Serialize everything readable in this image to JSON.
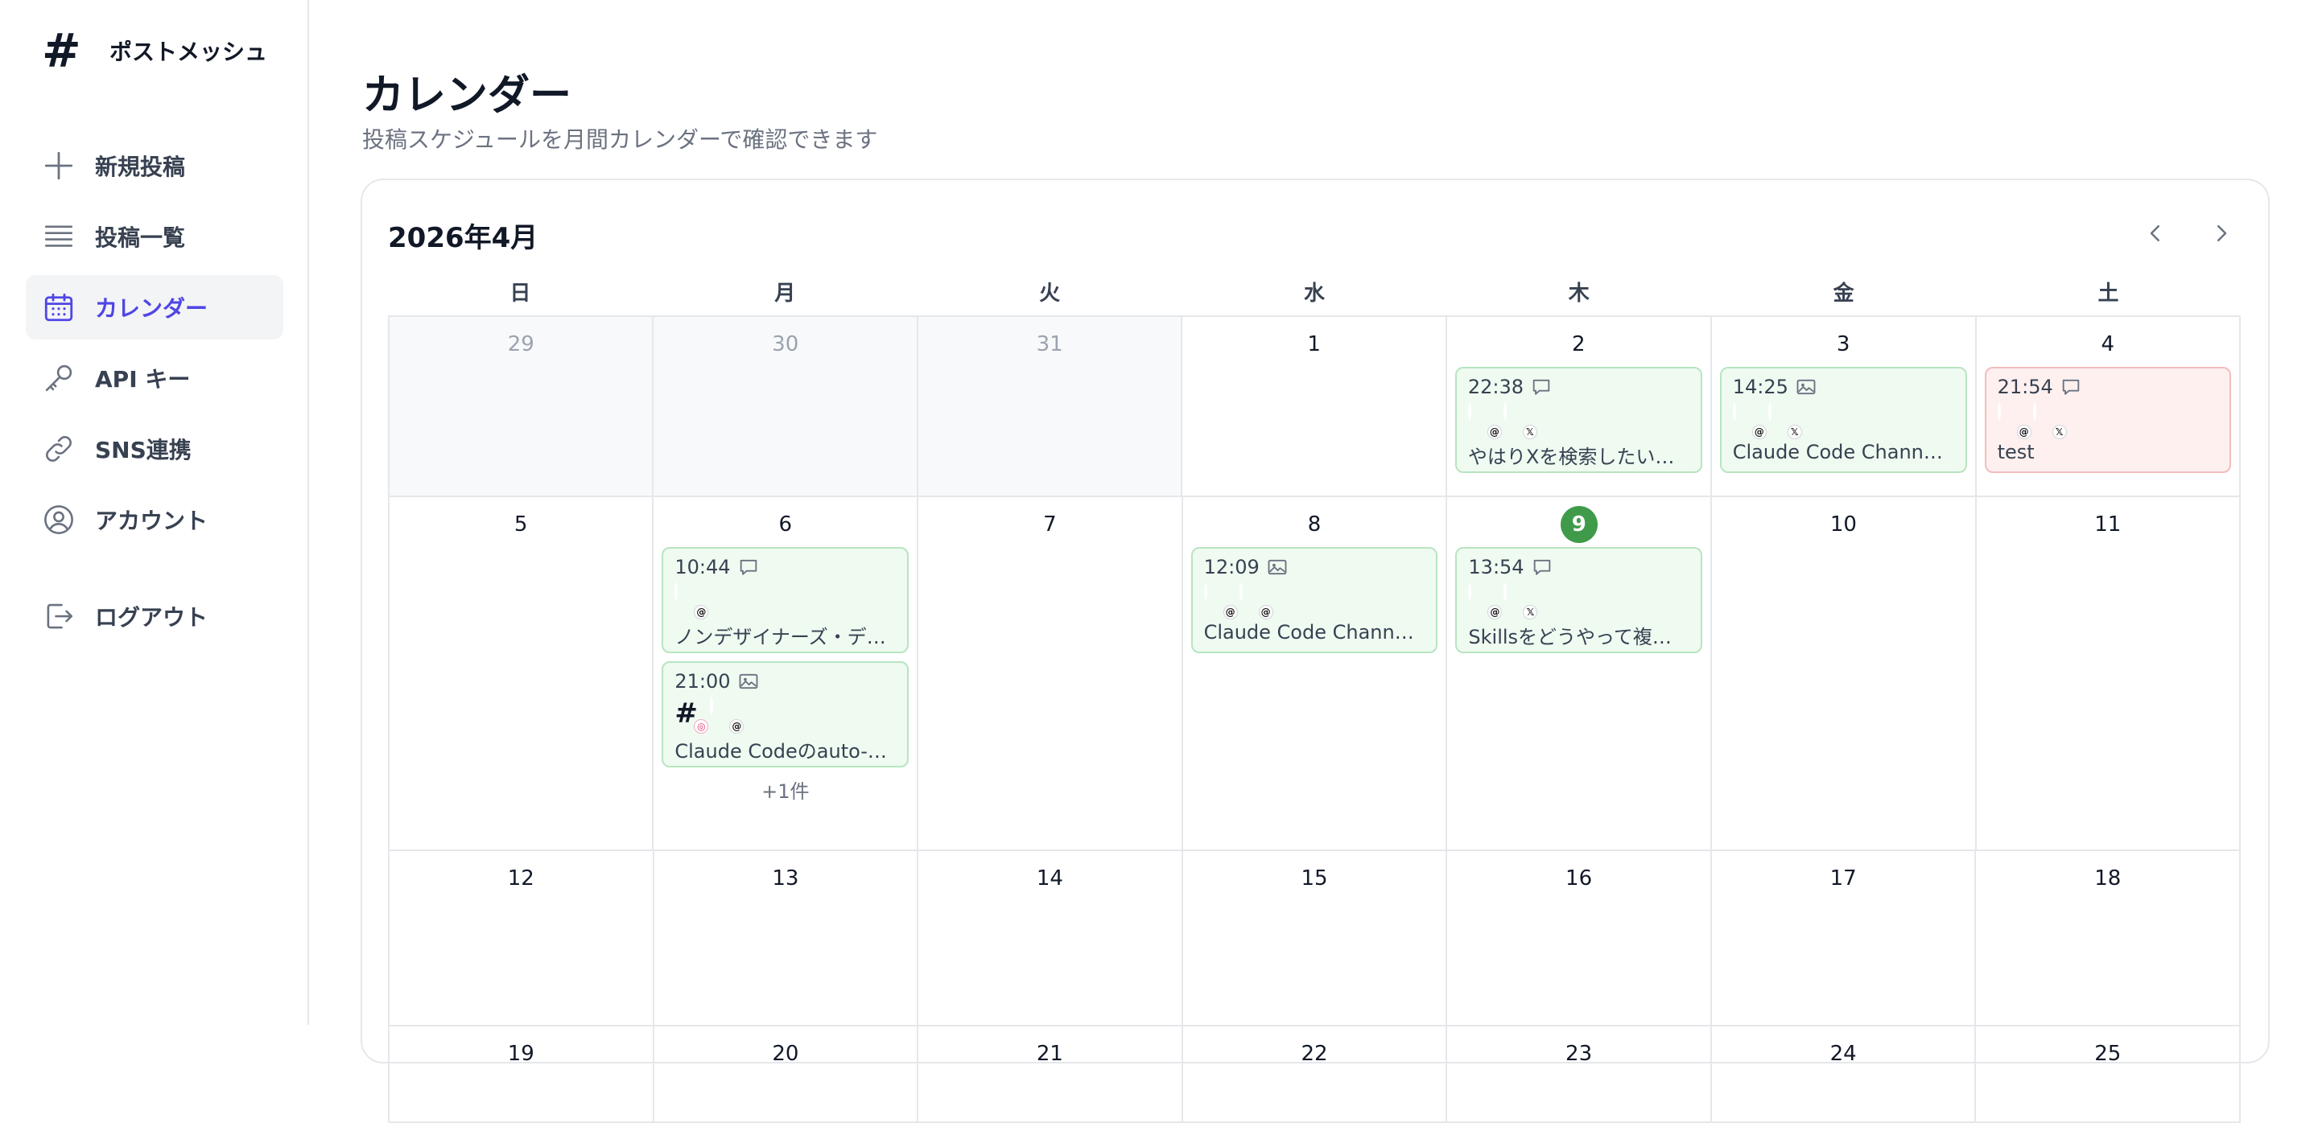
{
  "app": {
    "name": "ポストメッシュ"
  },
  "sidebar": {
    "items": [
      {
        "label": "新規投稿",
        "icon": "plus-icon",
        "active": false
      },
      {
        "label": "投稿一覧",
        "icon": "list-icon",
        "active": false
      },
      {
        "label": "カレンダー",
        "icon": "calendar-icon",
        "active": true
      },
      {
        "label": "API キー",
        "icon": "key-icon",
        "active": false
      },
      {
        "label": "SNS連携",
        "icon": "link-icon",
        "active": false
      },
      {
        "label": "アカウント",
        "icon": "user-circle-icon",
        "active": false
      }
    ],
    "logout": {
      "label": "ログアウト",
      "icon": "logout-icon"
    }
  },
  "page": {
    "title": "カレンダー",
    "subtitle": "投稿スケジュールを月間カレンダーで確認できます"
  },
  "calendar": {
    "month_label": "2026年4月",
    "weekdays": [
      "日",
      "月",
      "火",
      "水",
      "木",
      "金",
      "土"
    ],
    "weeks": [
      [
        {
          "day": "29",
          "other": true,
          "posts": []
        },
        {
          "day": "30",
          "other": true,
          "posts": []
        },
        {
          "day": "31",
          "other": true,
          "posts": []
        },
        {
          "day": "1",
          "posts": []
        },
        {
          "day": "2",
          "posts": [
            {
              "time": "22:38",
              "type": "text",
              "status": "success",
              "accounts": [
                "threads",
                "x"
              ],
              "text": "やはりXを検索したい時…"
            }
          ]
        },
        {
          "day": "3",
          "posts": [
            {
              "time": "14:25",
              "type": "image",
              "status": "success",
              "accounts": [
                "threads",
                "x"
              ],
              "text": "Claude Code Channel…"
            }
          ]
        },
        {
          "day": "4",
          "posts": [
            {
              "time": "21:54",
              "type": "text",
              "status": "failed",
              "accounts": [
                "threads",
                "x"
              ],
              "text": "test"
            }
          ]
        }
      ],
      [
        {
          "day": "5",
          "posts": []
        },
        {
          "day": "6",
          "posts": [
            {
              "time": "10:44",
              "type": "text",
              "status": "success",
              "accounts": [
                "threads"
              ],
              "text": "ノンデザイナーズ・デザ…"
            },
            {
              "time": "21:00",
              "type": "image",
              "status": "success",
              "accounts": [
                "instagram",
                "threads"
              ],
              "text": "Claude Codeのauto-me…"
            }
          ],
          "more": "+1件"
        },
        {
          "day": "7",
          "posts": []
        },
        {
          "day": "8",
          "posts": [
            {
              "time": "12:09",
              "type": "image",
              "status": "success",
              "accounts": [
                "threads",
                "threads"
              ],
              "text": "Claude Code Channel…"
            }
          ]
        },
        {
          "day": "9",
          "today": true,
          "posts": [
            {
              "time": "13:54",
              "type": "text",
              "status": "success",
              "accounts": [
                "threads",
                "x"
              ],
              "text": "Skillsをどうやって複数…"
            }
          ]
        },
        {
          "day": "10",
          "posts": []
        },
        {
          "day": "11",
          "posts": []
        }
      ],
      [
        {
          "day": "12",
          "posts": []
        },
        {
          "day": "13",
          "posts": []
        },
        {
          "day": "14",
          "posts": []
        },
        {
          "day": "15",
          "posts": []
        },
        {
          "day": "16",
          "posts": []
        },
        {
          "day": "17",
          "posts": []
        },
        {
          "day": "18",
          "posts": []
        }
      ],
      [
        {
          "day": "19",
          "posts": []
        },
        {
          "day": "20",
          "posts": []
        },
        {
          "day": "21",
          "posts": []
        },
        {
          "day": "22",
          "posts": []
        },
        {
          "day": "23",
          "posts": []
        },
        {
          "day": "24",
          "posts": []
        },
        {
          "day": "25",
          "posts": []
        }
      ]
    ]
  },
  "colors": {
    "accent": "#4f46e5",
    "today": "#3f9a4a",
    "post_success_bg": "#effaf1",
    "post_failed_bg": "#fdf0ef"
  }
}
